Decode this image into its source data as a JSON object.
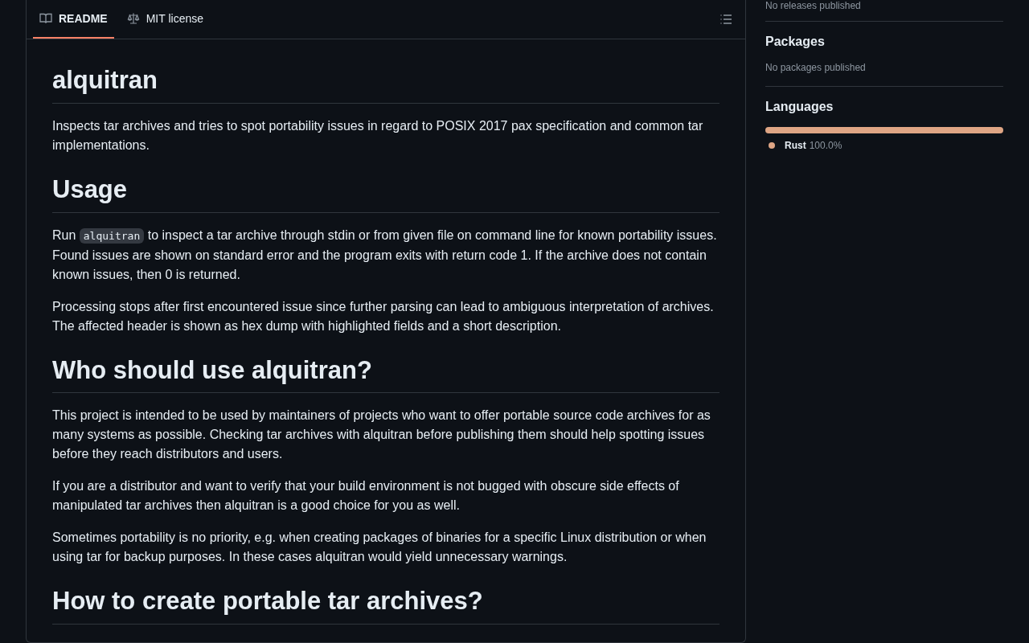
{
  "readme_tabs": [
    {
      "label": "README",
      "kind": "book",
      "selected": true
    },
    {
      "label": "MIT license",
      "kind": "scale",
      "selected": false
    }
  ],
  "content": [
    {
      "kind": "heading",
      "text": "alquitran"
    },
    {
      "kind": "paragraph",
      "parts": [
        {
          "kind": "text",
          "text": "Inspects tar archives and tries to spot portability issues in regard to POSIX 2017 pax specification and common tar implementations."
        }
      ]
    },
    {
      "kind": "heading",
      "text": "Usage"
    },
    {
      "kind": "paragraph",
      "parts": [
        {
          "kind": "text",
          "text": "Run "
        },
        {
          "kind": "code",
          "text": "alquitran"
        },
        {
          "kind": "text",
          "text": " to inspect a tar archive through stdin or from given file on command line for known portability issues. Found issues are shown on standard error and the program exits with return code 1. If the archive does not contain known issues, then 0 is returned."
        }
      ]
    },
    {
      "kind": "paragraph",
      "parts": [
        {
          "kind": "text",
          "text": "Processing stops after first encountered issue since further parsing can lead to ambiguous interpretation of archives. The affected header is shown as hex dump with highlighted fields and a short description."
        }
      ]
    },
    {
      "kind": "heading",
      "text": "Who should use alquitran?"
    },
    {
      "kind": "paragraph",
      "parts": [
        {
          "kind": "text",
          "text": "This project is intended to be used by maintainers of projects who want to offer portable source code archives for as many systems as possible. Checking tar archives with alquitran before publishing them should help spotting issues before they reach distributors and users."
        }
      ]
    },
    {
      "kind": "paragraph",
      "parts": [
        {
          "kind": "text",
          "text": "If you are a distributor and want to verify that your build environment is not bugged with obscure side effects of manipulated tar archives then alquitran is a good choice for you as well."
        }
      ]
    },
    {
      "kind": "paragraph",
      "parts": [
        {
          "kind": "text",
          "text": "Sometimes portability is no priority, e.g. when creating packages of binaries for a specific Linux distribution or when using tar for backup purposes. In these cases alquitran would yield unnecessary warnings."
        }
      ]
    },
    {
      "kind": "heading",
      "text": "How to create portable tar archives?"
    }
  ],
  "sidebar": {
    "releases_note": "No releases published",
    "packages": {
      "title": "Packages",
      "note": "No packages published"
    },
    "languages": {
      "title": "Languages",
      "items": [
        {
          "name": "Rust",
          "percent": "100.0%",
          "level": 1.0,
          "color": "#dea584"
        }
      ]
    }
  }
}
